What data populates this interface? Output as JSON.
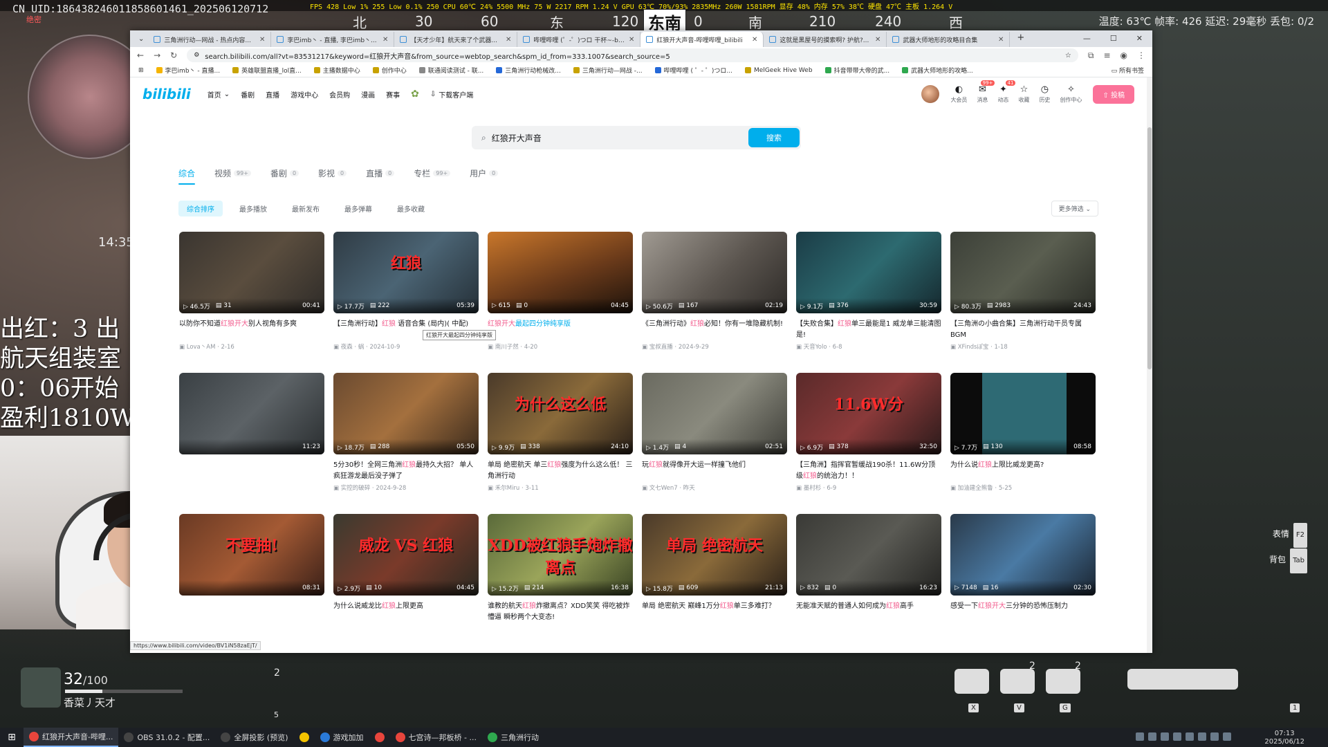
{
  "game": {
    "uid": "CN UID:18643824601185860146​1_2025061207​12",
    "uid_sub": "绝密",
    "hud_stats": "FPS 428  Low 1% 255  Low 0.1% 250  CPU 60℃ 24%  5500 MHz 75 W  2217 RPM  1.24 V  GPU 63℃ 70%/93%  2835MHz 260W 1581RPM  显存 48%  内存 57%  38℃  硬盘 47℃  主板 1.264 V",
    "compass": {
      "w": "北",
      "c1": "30",
      "c2": "60",
      "e": "东",
      "c3": "120",
      "current": "东南",
      "c4": "0",
      "s": "南",
      "c5": "210",
      "c6": "240",
      "sw": "西"
    },
    "stats_right": "温度: 63℃   帧率: 426   延迟: 29毫秒   丢包: 0/2",
    "clock": "14:35",
    "overlay_lines": [
      "出红：3 出",
      "航天组装室",
      "0：06开始",
      "盈利1810W"
    ],
    "hp": "32",
    "hp_max": "/100",
    "hp_fraction": 0.32,
    "player_name": "香菜丿天才",
    "slot_count": "2",
    "slot_key": "5",
    "expression_label": "表情",
    "expression_key": "F2",
    "backpack_label": "背包",
    "backpack_key": "Tab",
    "weapon_counts": [
      "2",
      "2"
    ],
    "weapon_keys": [
      "X",
      "V",
      "G",
      "1"
    ]
  },
  "browser": {
    "tabs": [
      {
        "title": "三角洲行动—网战 - 热点内容...",
        "active": false
      },
      {
        "title": "李巴imb丶 - 直播, 李巴imb丶...",
        "active": false
      },
      {
        "title": "【天才少年】航天来了个武器...",
        "active": false
      },
      {
        "title": "哔哩哔哩 (゜-゜)つロ 干杯~-bi...",
        "active": false
      },
      {
        "title": "红狼开大声音-哔哩哔哩_bilibili",
        "active": true
      },
      {
        "title": "这就是黑屋号的摸索啊? 护航?...",
        "active": false
      },
      {
        "title": "武器大师地形的攻略目合集",
        "active": false
      }
    ],
    "url": "search.bilibili.com/all?vt=83531217&keyword=红狼开大声音&from_source=webtop_search&spm_id_from=333.1007&search_source=5",
    "bookmarks": [
      {
        "label": "李巴imb丶 - 直播...",
        "color": "#f5b400"
      },
      {
        "label": "英雄联盟直播_lol直...",
        "color": "#c8a200"
      },
      {
        "label": "主播数据中心",
        "color": "#c8a200"
      },
      {
        "label": "创作中心",
        "color": "#c8a200"
      },
      {
        "label": "联通阅读测试 - 联...",
        "color": "#888888"
      },
      {
        "label": "三角洲行动枪械改...",
        "color": "#2468d8"
      },
      {
        "label": "三角洲行动—网战 -...",
        "color": "#c8a200"
      },
      {
        "label": "哔哩哔哩 ( ゜- ゜)つロ...",
        "color": "#2468d8"
      },
      {
        "label": "MelGeek Hive Web",
        "color": "#c8a200"
      },
      {
        "label": "抖音带带大帝的武...",
        "color": "#2fa84f"
      },
      {
        "label": "武器大师地形的攻略...",
        "color": "#2fa84f"
      }
    ],
    "all_bookmarks": "所有书签",
    "status_url": "https://www.bilibili.com/video/BV1iN58zaEjT/"
  },
  "bili": {
    "logo": "bilibili",
    "nav": [
      "首页",
      "番剧",
      "直播",
      "游戏中心",
      "会员购",
      "漫画",
      "赛事"
    ],
    "download": "下载客户端",
    "right_nav": [
      {
        "label": "大会员",
        "icon": "◐",
        "badge": ""
      },
      {
        "label": "消息",
        "icon": "✉",
        "badge": "99+"
      },
      {
        "label": "动态",
        "icon": "✦",
        "badge": "41"
      },
      {
        "label": "收藏",
        "icon": "☆",
        "badge": ""
      },
      {
        "label": "历史",
        "icon": "◷",
        "badge": ""
      },
      {
        "label": "创作中心",
        "icon": "✧",
        "badge": ""
      }
    ],
    "upload": "投稿",
    "search_value": "红狼开大声音",
    "search_button": "搜索",
    "type_tabs": [
      {
        "label": "综合",
        "count": ""
      },
      {
        "label": "视频",
        "count": "99+"
      },
      {
        "label": "番剧",
        "count": "0"
      },
      {
        "label": "影视",
        "count": "0"
      },
      {
        "label": "直播",
        "count": "0"
      },
      {
        "label": "专栏",
        "count": "99+"
      },
      {
        "label": "用户",
        "count": "0"
      }
    ],
    "sorts": [
      "综合排序",
      "最多播放",
      "最新发布",
      "最多弹幕",
      "最多收藏"
    ],
    "filter": "更多筛选",
    "tooltip": "红狼开大最起四分钟纯享版",
    "videos": [
      {
        "views": "46.5万",
        "danmaku": "31",
        "duration": "00:41",
        "pre": "以防你不知道",
        "hl": "红狼开大",
        "post": "别人视角有多爽",
        "meta": "Lova丶AM · 2-16",
        "overlay": "",
        "bg": "linear-gradient(135deg,#3a3530,#5a4d3e 50%,#2e2b28)"
      },
      {
        "views": "17.7万",
        "danmaku": "222",
        "duration": "05:39",
        "pre": "【三角洲行动】",
        "hl": "红狼",
        "post": " 语音合集 (局内)( 中配)",
        "meta": "夜森 · 蜗 · 2024-10-9",
        "overlay": "红狼",
        "bg": "linear-gradient(135deg,#2f3b44,#4b6474 50%,#253038)"
      },
      {
        "views": "615",
        "danmaku": "0",
        "duration": "04:45",
        "pre": "",
        "hl": "红狼开大",
        "post": "最起四分钟纯享版",
        "meta": "南川子然 · 4-20",
        "overlay": "",
        "bg": "linear-gradient(160deg,#c9772b,#6a3a1a 55%,#1c120b)",
        "hover": true
      },
      {
        "views": "50.6万",
        "danmaku": "167",
        "duration": "02:19",
        "pre": "《三角洲行动》",
        "hl": "红狼",
        "post": "必知！你有一堆隐藏机制!",
        "meta": "宝叔直播 · 2024-9-29",
        "overlay": "",
        "bg": "linear-gradient(135deg,#a09a92,#5b554f 55%,#2d2a27)"
      },
      {
        "views": "9.1万",
        "danmaku": "376",
        "duration": "30:59",
        "pre": "【失败合集】",
        "hl": "红狼",
        "post": "单三最能是1 威龙单三能清图是!",
        "meta": "天音Yolo · 6-8",
        "overlay": "",
        "bg": "linear-gradient(135deg,#1b3c46,#2d6a70 50%,#15282e)"
      },
      {
        "views": "80.3万",
        "danmaku": "2983",
        "duration": "24:43",
        "pre": "【三角洲の小曲合集】三角洲行动干员专属BGM",
        "hl": "",
        "post": "",
        "meta": "XFindsぽ宝 · 1-18",
        "overlay": "",
        "bg": "linear-gradient(135deg,#3c4038,#5a5e50 50%,#2a2c26)"
      },
      {
        "views": "",
        "danmaku": "",
        "duration": "11:23",
        "pre": "",
        "hl": "",
        "post": "",
        "meta": "",
        "overlay": "",
        "bg": "linear-gradient(135deg,#3a4044,#5c6266 50%,#2a2e30)"
      },
      {
        "views": "18.7万",
        "danmaku": "288",
        "duration": "05:50",
        "pre": "5分30秒！全网三角洲",
        "hl": "红狼",
        "post": "最持久大招？ 单人疯狂游龙最后没子弹了",
        "meta": "实控的破碎 · 2024-9-28",
        "overlay": "",
        "bg": "linear-gradient(135deg,#6a4a30,#a4703e 50%,#3a2a1c)"
      },
      {
        "views": "9.9万",
        "danmaku": "338",
        "duration": "24:10",
        "pre": "单局 绝密航天 单三",
        "hl": "红狼",
        "post": "强度为什么这么低！ 三角洲行动",
        "meta": "禾尔Miru · 3-11",
        "overlay": "为什么这么低",
        "bg": "linear-gradient(135deg,#4a3a2a,#8a6a3a 50%,#2a2018)"
      },
      {
        "views": "1.4万",
        "danmaku": "4",
        "duration": "02:51",
        "pre": "玩",
        "hl": "红狼",
        "post": "就得像开大运一样撞飞他们",
        "meta": "文七Wen7 · 昨天",
        "overlay": "",
        "bg": "linear-gradient(135deg,#6a6a60,#8a8a7e 50%,#3e3e38)"
      },
      {
        "views": "6.9万",
        "danmaku": "378",
        "duration": "32:50",
        "pre": "【三角洲】指挥官暂缓战190杀！11.6W分顶级",
        "hl": "红狼",
        "post": "的统治力！！",
        "meta": "墨村杉 · 6-9",
        "overlay": "11.6W分",
        "bg": "linear-gradient(135deg,#5a2a2a,#8a3a3a 50%,#2a1a1a)"
      },
      {
        "views": "7.7万",
        "danmaku": "130",
        "duration": "08:58",
        "pre": "为什么说",
        "hl": "红狼",
        "post": "上限比威龙更高?",
        "meta": "加油建全熊鲁 · 5-25",
        "overlay": "",
        "bg": "linear-gradient(90deg,#0c0c0c 0 22%,#2e6a74 22% 80%,#0c0c0c 80%)"
      },
      {
        "views": "",
        "danmaku": "",
        "duration": "08:31",
        "pre": "",
        "hl": "",
        "post": "",
        "meta": "",
        "overlay": "不要抽!",
        "bg": "linear-gradient(135deg,#6a3a24,#a45a34 50%,#3a2018)"
      },
      {
        "views": "2.9万",
        "danmaku": "10",
        "duration": "04:45",
        "pre": "为什么说威龙比",
        "hl": "红狼",
        "post": "上限更高",
        "meta": "",
        "overlay": "威龙 VS 红狼",
        "bg": "linear-gradient(135deg,#3a3a30,#7a3a2a 50%,#2a2a22)"
      },
      {
        "views": "15.2万",
        "danmaku": "214",
        "duration": "16:38",
        "pre": "谁教的航天",
        "hl": "红狼",
        "post": "炸撤离点？XDD笑笑 得吃被炸懵逼 瞬秒两个大变态!",
        "meta": "",
        "overlay": "XDD被红狼手炮炸撤离点",
        "bg": "linear-gradient(135deg,#5a6a3a,#9aa45a 50%,#3a4424)"
      },
      {
        "views": "15.8万",
        "danmaku": "609",
        "duration": "21:13",
        "pre": "单局 绝密航天 巅峰1万分",
        "hl": "红狼",
        "post": "单三多难打？",
        "meta": "",
        "overlay": "单局 绝密航天",
        "bg": "linear-gradient(135deg,#4a3a2a,#8a6a3a 50%,#2a2018)"
      },
      {
        "views": "832",
        "danmaku": "0",
        "duration": "16:23",
        "pre": "无能准天赋的普通人如何成为",
        "hl": "红狼",
        "post": "高手",
        "meta": "",
        "overlay": "",
        "bg": "linear-gradient(135deg,#3a3a36,#5a5a54 50%,#222220)"
      },
      {
        "views": "7148",
        "danmaku": "16",
        "duration": "02:30",
        "pre": "感受一下",
        "hl": "红狼开大",
        "post": "三分钟的恐怖压制力",
        "meta": "",
        "overlay": "",
        "bg": "linear-gradient(135deg,#2a3a4a,#4a7aa4 50%,#1a2430)"
      }
    ]
  },
  "taskbar": {
    "items": [
      {
        "label": "红狼开大声音-哔哩...",
        "color": "#e8453c",
        "active": true
      },
      {
        "label": "OBS 31.0.2 - 配置...",
        "color": "#444444",
        "active": false
      },
      {
        "label": "全屏投影 (预览)",
        "color": "#444444",
        "active": false
      },
      {
        "label": "",
        "color": "#f5c400",
        "active": false
      },
      {
        "label": "游戏加加",
        "color": "#2a7ad8",
        "active": false
      },
      {
        "label": "",
        "color": "#e8453c",
        "active": false
      },
      {
        "label": "七宫诗—邦板桥 - ...",
        "color": "#e8453c",
        "active": false
      },
      {
        "label": "三角洲行动",
        "color": "#2fa84f",
        "active": false
      }
    ],
    "time": "07:13",
    "date": "2025/06/12"
  }
}
